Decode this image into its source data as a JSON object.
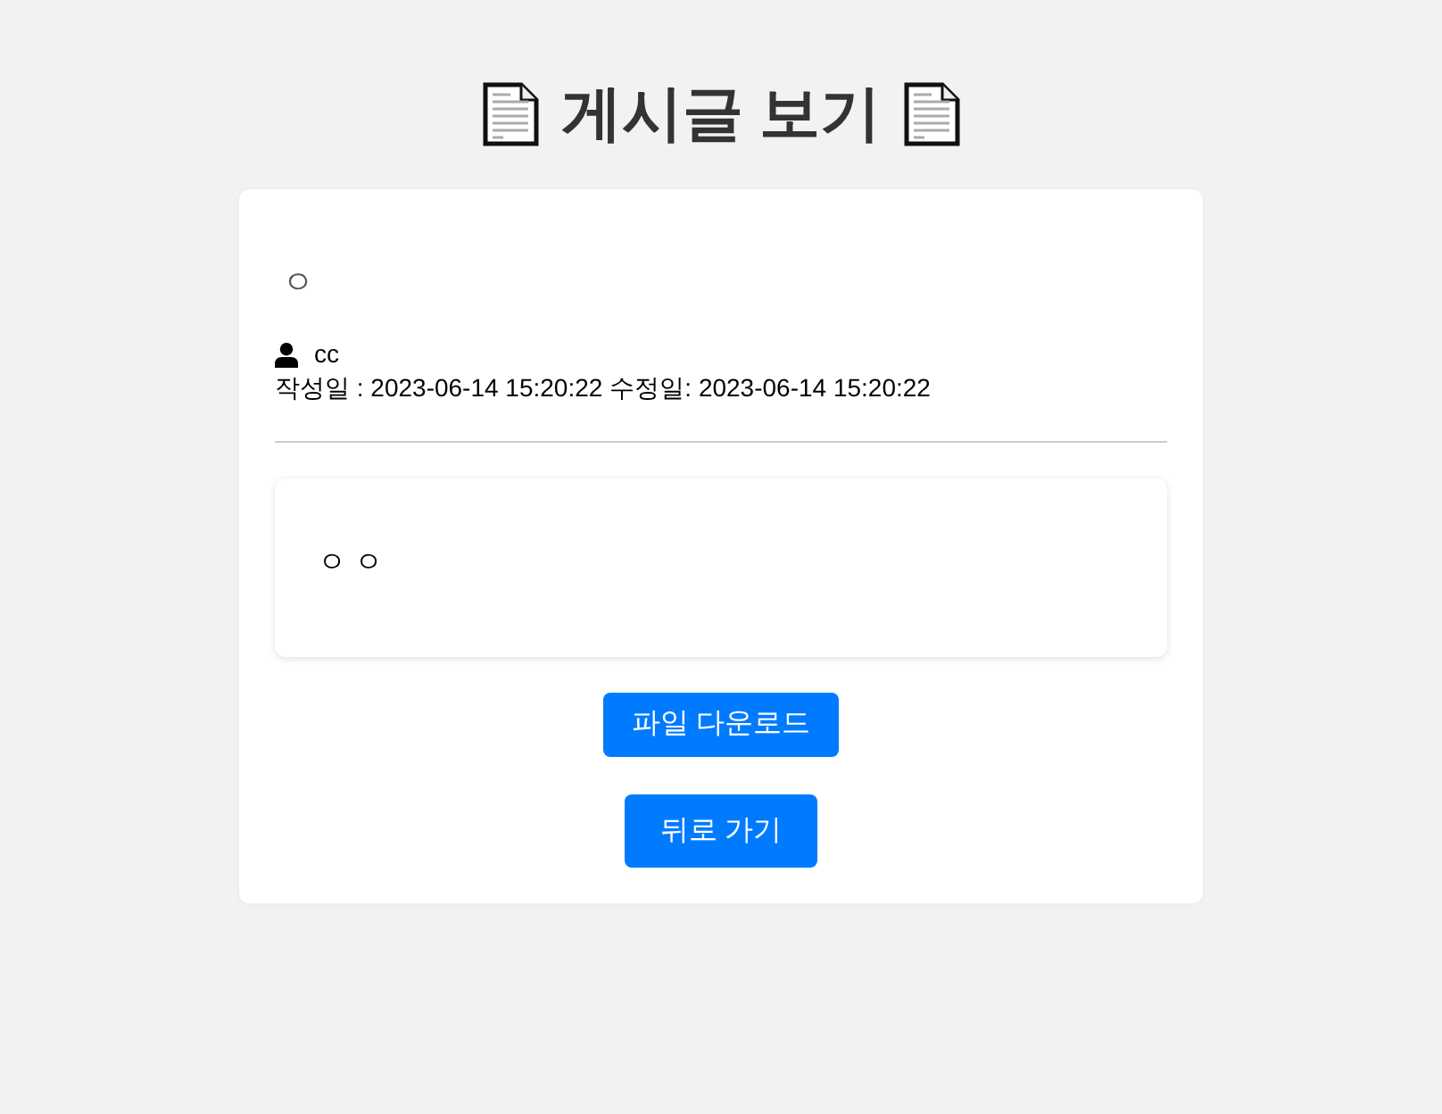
{
  "page": {
    "title": "게시글 보기"
  },
  "post": {
    "title": "ㅇ",
    "author": "cc",
    "created": "작성일 : 2023-06-14 15:20:22",
    "modified": "수정일: 2023-06-14 15:20:22",
    "content": "ㅇ ㅇ"
  },
  "buttons": [
    {
      "label": "파일 다운로드",
      "kind": "download"
    },
    {
      "label": "뒤로 가기",
      "kind": "back"
    }
  ]
}
